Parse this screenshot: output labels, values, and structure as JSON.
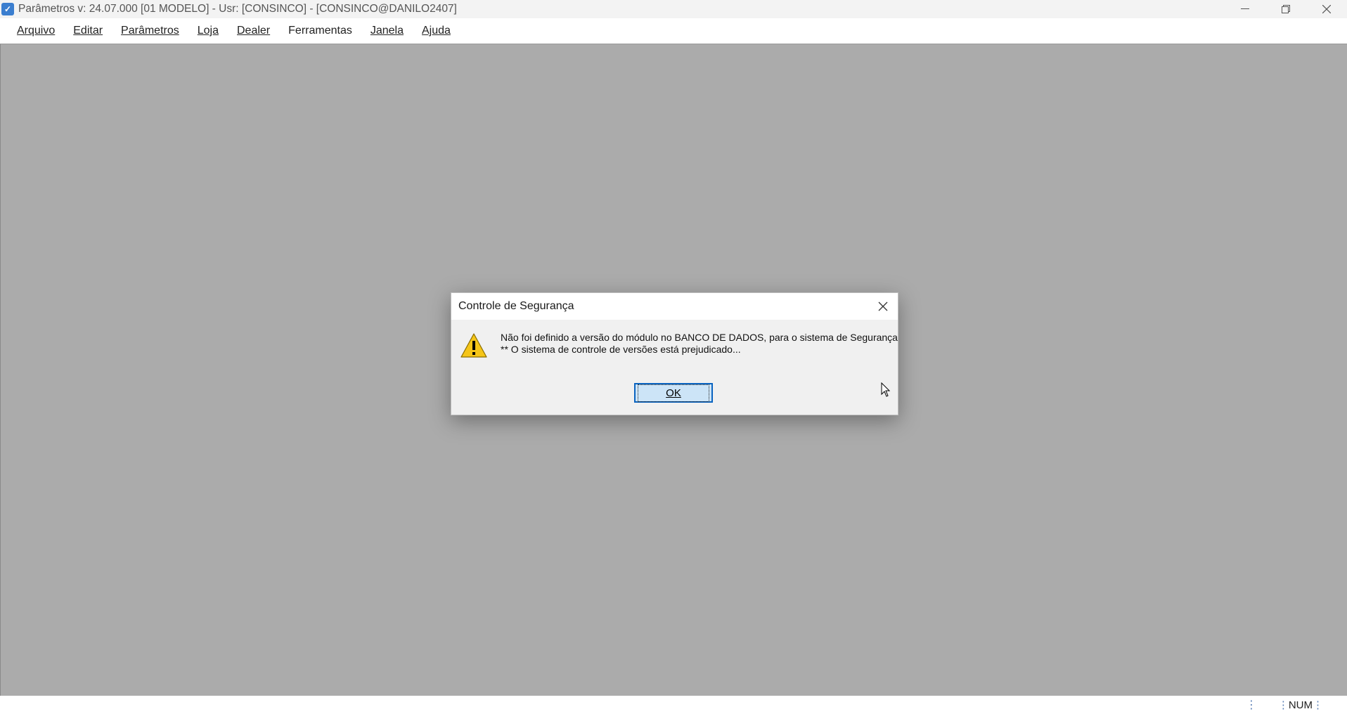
{
  "window": {
    "title": "Parâmetros  v: 24.07.000   [01 MODELO] - Usr: [CONSINCO] - [CONSINCO@DANILO2407]",
    "icon": "app-logo-icon",
    "controls": [
      "minimize-icon",
      "restore-icon",
      "close-icon"
    ]
  },
  "menu": {
    "items": [
      {
        "label": "Arquivo",
        "accel": "A"
      },
      {
        "label": "Editar",
        "accel": "E"
      },
      {
        "label": "Parâmetros",
        "accel": "P"
      },
      {
        "label": "Loja",
        "accel": "L"
      },
      {
        "label": "Dealer",
        "accel": "D"
      },
      {
        "label": "Ferramentas",
        "accel": ""
      },
      {
        "label": "Janela",
        "accel": "J"
      },
      {
        "label": "Ajuda",
        "accel": "j"
      }
    ]
  },
  "dialog": {
    "title": "Controle de Segurança",
    "icon": "warning-icon",
    "message_line1": "Não foi definido a versão do módulo no BANCO DE DADOS, para o sistema de Segurança",
    "message_line2": "** O sistema de controle de versões está prejudicado...",
    "ok_label": "OK"
  },
  "statusbar": {
    "num_indicator": "NUM"
  },
  "colors": {
    "mdi_background": "#ababab",
    "button_face": "#cce4f7",
    "button_border": "#0a64c0",
    "warning_yellow": "#f5c518"
  }
}
